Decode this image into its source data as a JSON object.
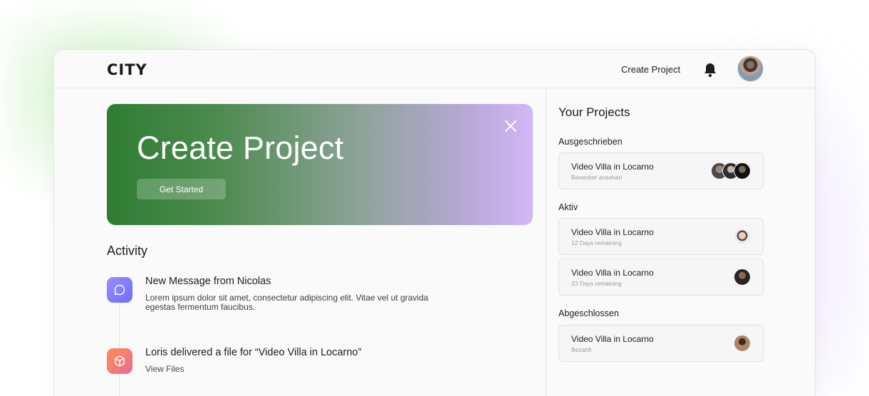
{
  "header": {
    "logo": "CITY",
    "create_project_link": "Create Project"
  },
  "banner": {
    "title": "Create Project",
    "button_label": "Get Started"
  },
  "activity": {
    "title": "Activity",
    "items": [
      {
        "title": "New Message from Nicolas",
        "description": "Lorem ipsum dolor sit amet, consectetur adipiscing elit. Vitae vel ut gravida egestas fermentum faucibus.",
        "icon": "chat-bubble-icon"
      },
      {
        "title": "Loris delivered a file for “Video Villa in Locarno”",
        "description": "View Files",
        "icon": "cube-icon"
      }
    ]
  },
  "projects": {
    "title": "Your Projects",
    "sections": [
      {
        "label": "Ausgeschrieben",
        "cards": [
          {
            "title": "Video Villa in Locarno",
            "subtitle": "Bewerber ansehen"
          }
        ]
      },
      {
        "label": "Aktiv",
        "cards": [
          {
            "title": "Video Villa in Locarno",
            "subtitle": "12 Days remaining"
          },
          {
            "title": "Video Villa in Locarno",
            "subtitle": "23 Days remaining"
          }
        ]
      },
      {
        "label": "Abgeschlossen",
        "cards": [
          {
            "title": "Video Villa in Locarno",
            "subtitle": "Bezahlt"
          }
        ]
      }
    ]
  },
  "colors": {
    "banner_start": "#2f7d33",
    "banner_end": "#d2b7f5",
    "message_icon": "#7a78ff",
    "file_icon": "#f27b6e"
  }
}
